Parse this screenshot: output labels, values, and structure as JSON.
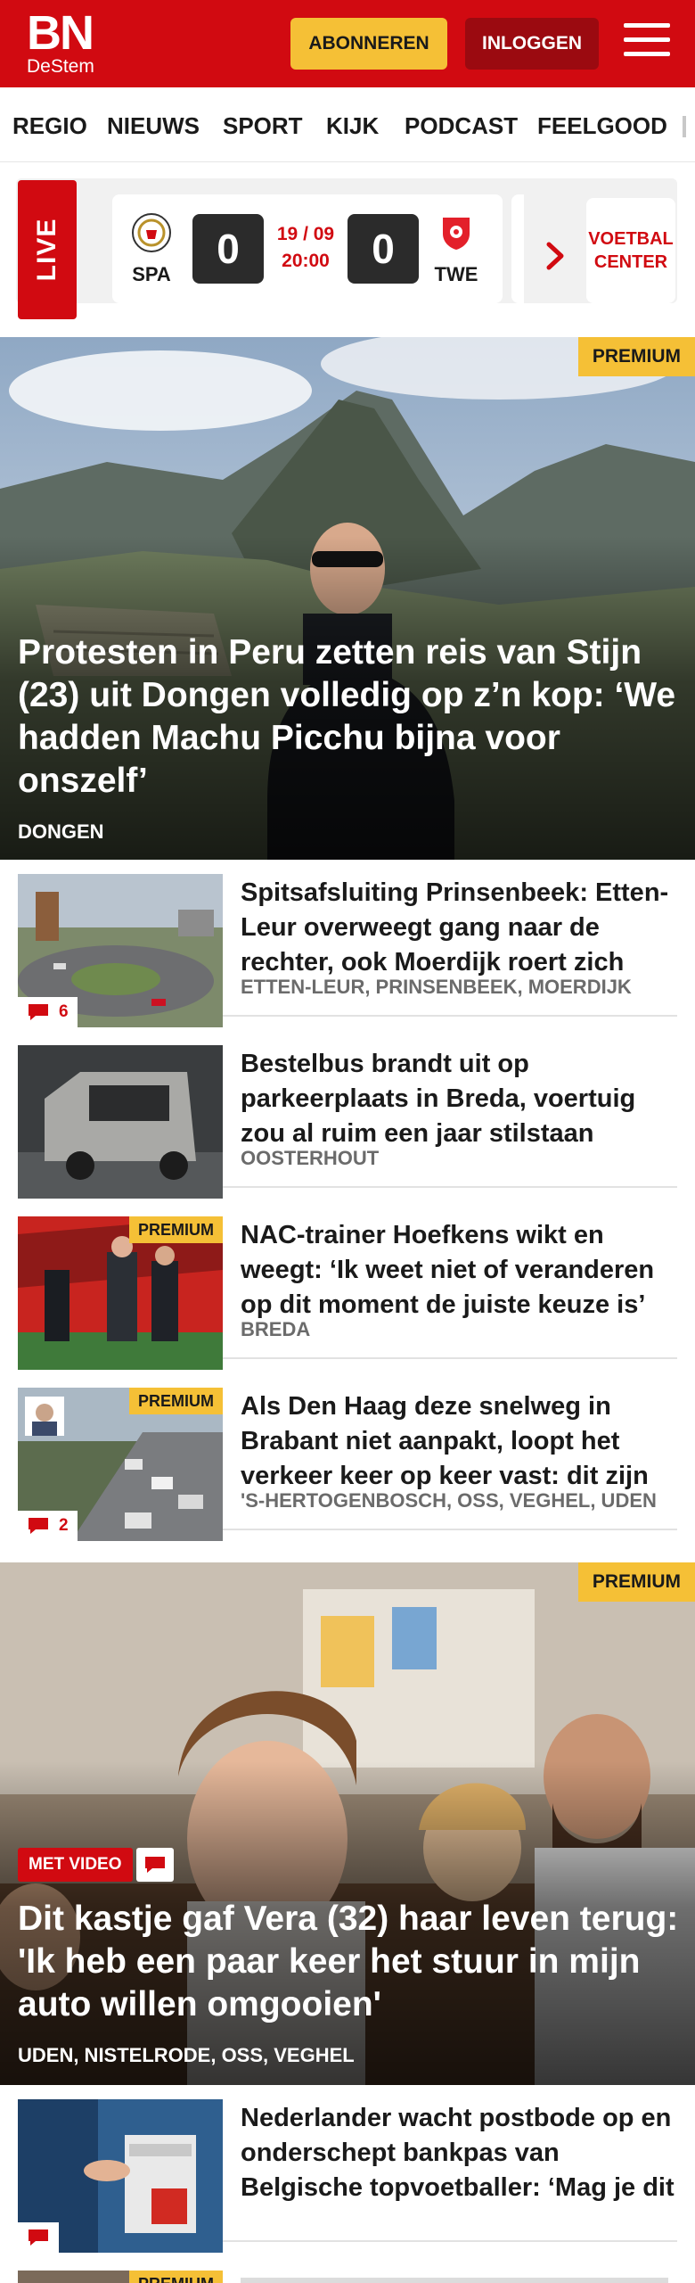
{
  "header": {
    "logo_main": "BN",
    "logo_sub": "DeStem",
    "subscribe_label": "ABONNEREN",
    "login_label": "INLOGGEN",
    "menu_icon": "hamburger-icon",
    "brand_color": "#d10a11",
    "accent_color": "#f5c036"
  },
  "nav": {
    "items": [
      {
        "label": "REGIO"
      },
      {
        "label": "NIEUWS"
      },
      {
        "label": "SPORT"
      },
      {
        "label": "KIJK"
      },
      {
        "label": "PODCAST"
      },
      {
        "label": "FEELGOOD"
      }
    ]
  },
  "live": {
    "tag": "LIVE",
    "match": {
      "home": "SPA",
      "away": "TWE",
      "home_score": "0",
      "away_score": "0",
      "date": "19 / 09",
      "time": "20:00"
    },
    "center_label": "VOETBAL CENTER",
    "chevron_icon": "chevron-right-icon"
  },
  "hero1": {
    "badge": "PREMIUM",
    "title": "Protesten in Peru zetten reis van Stijn (23) uit Dongen volledig op z’n kop: ‘We hadden Machu Picchu bijna voor onszelf’",
    "location": "DONGEN"
  },
  "list1": [
    {
      "title": "Spitsafsluiting Prinsenbeek: Etten-Leur overweegt gang naar de rechter, ook Moerdijk roert zich",
      "location": "ETTEN-LEUR, PRINSENBEEK, MOERDIJK",
      "comments": "6",
      "premium": ""
    },
    {
      "title": "Bestelbus brandt uit op parkeerplaats in Breda, voertuig zou al ruim een jaar stilstaan",
      "location": "OOSTERHOUT",
      "comments": "",
      "premium": ""
    },
    {
      "title": "NAC-trainer Hoefkens wikt en weegt: ‘Ik weet niet of veranderen op dit moment de juiste keuze is’",
      "location": "BREDA",
      "comments": "",
      "premium": "PREMIUM"
    },
    {
      "title": "Als Den Haag deze snelweg in Brabant niet aanpakt, loopt het verkeer keer op keer vast: dit zijn de oplossingen",
      "location": "'S-HERTOGENBOSCH, OSS, VEGHEL, UDEN",
      "comments": "2",
      "premium": "PREMIUM"
    }
  ],
  "hero2": {
    "badge": "PREMIUM",
    "video_label": "MET VIDEO",
    "title": "Dit kastje gaf Vera (32) haar leven terug: 'Ik heb een paar keer het stuur in mijn auto willen omgooien'",
    "location": "UDEN, NISTELRODE, OSS, VEGHEL"
  },
  "list2": [
    {
      "title": "Nederlander wacht postbode op en onderschept bankpas van Belgische topvoetballer: ‘Mag je dit zomaar doen?’",
      "location": "",
      "comments": "",
      "premium": ""
    },
    {
      "title": "",
      "location": "",
      "comments": "",
      "premium": "PREMIUM"
    }
  ]
}
